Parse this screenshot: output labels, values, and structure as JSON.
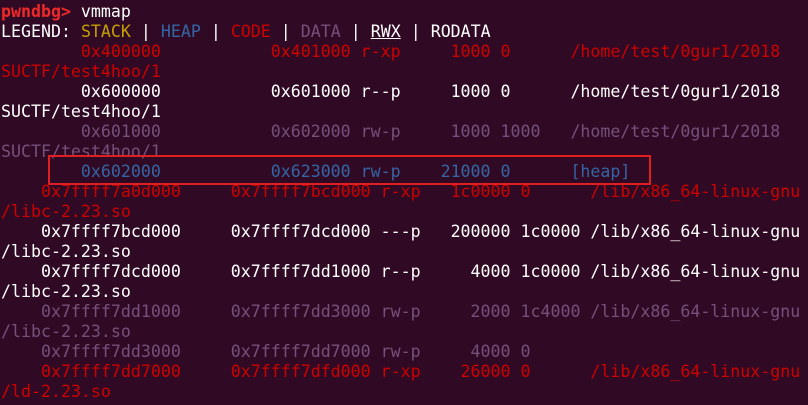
{
  "terminal": {
    "prompt": "pwndbg>",
    "command": " vmmap",
    "legend": {
      "label": "LEGEND: ",
      "sep": " | ",
      "stack": "STACK",
      "heap": "HEAP",
      "code": "CODE",
      "data": "DATA",
      "rwx": "RWX",
      "rodata": "RODATA"
    },
    "lines": [
      "        0x400000           0x401000 r-xp     1000 0      /home/test/0gur1/2018",
      "SUCTF/test4hoo/1",
      "        0x600000           0x601000 r--p     1000 0      /home/test/0gur1/2018",
      "SUCTF/test4hoo/1",
      "        0x601000           0x602000 rw-p     1000 1000   /home/test/0gur1/2018",
      "SUCTF/test4hoo/1",
      "        0x602000           0x623000 rw-p    21000 0      [heap]",
      "    0x7ffff7a0d000     0x7ffff7bcd000 r-xp   1c0000 0      /lib/x86_64-linux-gnu",
      "/libc-2.23.so",
      "    0x7ffff7bcd000     0x7ffff7dcd000 ---p   200000 1c0000 /lib/x86_64-linux-gnu",
      "/libc-2.23.so",
      "    0x7ffff7dcd000     0x7ffff7dd1000 r--p     4000 1c0000 /lib/x86_64-linux-gnu",
      "/libc-2.23.so",
      "    0x7ffff7dd1000     0x7ffff7dd3000 rw-p     2000 1c4000 /lib/x86_64-linux-gnu",
      "/libc-2.23.so",
      "    0x7ffff7dd3000     0x7ffff7dd7000 rw-p     4000 0",
      "    0x7ffff7dd7000     0x7ffff7dfd000 r-xp    26000 0      /lib/x86_64-linux-gnu",
      "/ld-2.23.so"
    ],
    "line_colors": [
      "#cc0000",
      "#cc0000",
      "#ffffff",
      "#ffffff",
      "#75507b",
      "#75507b",
      "#3465a4",
      "#cc0000",
      "#cc0000",
      "#ffffff",
      "#ffffff",
      "#ffffff",
      "#ffffff",
      "#75507b",
      "#75507b",
      "#75507b",
      "#cc0000",
      "#cc0000"
    ],
    "highlight_color": "#e02020",
    "background_color": "#300a24"
  }
}
